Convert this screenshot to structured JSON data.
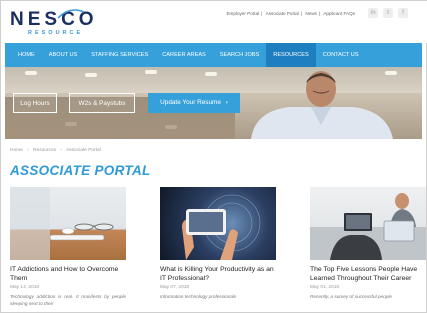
{
  "brand": {
    "logo_main": "NESCO",
    "logo_sub": "RESOURCE",
    "colors": {
      "navy": "#1b2f63",
      "blue": "#36a0db",
      "blue_dark": "#1e7fc0"
    }
  },
  "top_links": [
    "Employer Portal",
    "Associate Portal",
    "News",
    "Applicant FAQs"
  ],
  "social": [
    {
      "icon": "linkedin-icon",
      "glyph": "in"
    },
    {
      "icon": "twitter-icon",
      "glyph": "t"
    },
    {
      "icon": "facebook-icon",
      "glyph": "f"
    }
  ],
  "nav": {
    "items": [
      "HOME",
      "ABOUT US",
      "STAFFING SERVICES",
      "CAREER AREAS",
      "SEARCH JOBS",
      "RESOURCES",
      "CONTACT US"
    ],
    "active": "RESOURCES"
  },
  "hero": {
    "buttons": [
      {
        "label": "Log Hours",
        "style": "outline"
      },
      {
        "label": "W2s & Paystubs",
        "style": "outline"
      },
      {
        "label": "Update Your Resume",
        "style": "filled",
        "icon": "chevron-right-icon"
      }
    ]
  },
  "breadcrumb": [
    "Home",
    "Resources",
    "Associate Portal"
  ],
  "page_title": "ASSOCIATE PORTAL",
  "cards": [
    {
      "title": "IT Addictions and How to Overcome Them",
      "date": "May 14, 2018",
      "excerpt": "Technology addiction is real. It manifests by people sleeping next to their"
    },
    {
      "title": "What is Killing Your Productivity as an IT Professional?",
      "date": "May 07, 2018",
      "excerpt": "Information technology professionals"
    },
    {
      "title": "The Top Five Lessons People Have Learned Throughout Their Career",
      "date": "May 01, 2018",
      "excerpt": "Recently, a survey of successful people"
    }
  ]
}
